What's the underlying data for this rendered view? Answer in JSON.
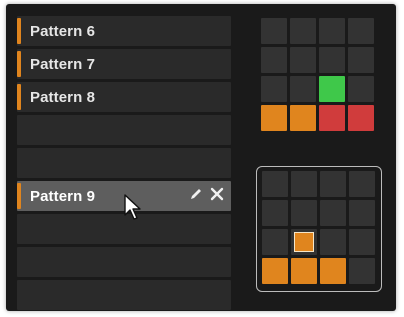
{
  "patterns": {
    "rows": [
      {
        "label": "Pattern 6",
        "has_marker": true
      },
      {
        "label": "Pattern 7",
        "has_marker": true
      },
      {
        "label": "Pattern 8",
        "has_marker": true
      },
      {
        "label": "",
        "has_marker": false
      },
      {
        "label": "",
        "has_marker": false
      },
      {
        "label": "Pattern 9",
        "has_marker": true,
        "selected": true
      },
      {
        "label": "",
        "has_marker": false
      },
      {
        "label": "",
        "has_marker": false
      },
      {
        "label": "",
        "has_marker": false
      }
    ],
    "selected_actions": {
      "edit_icon": "pencil-icon",
      "delete_icon": "close-icon"
    }
  },
  "pad_grids": {
    "top": [
      "off",
      "off",
      "off",
      "off",
      "off",
      "off",
      "off",
      "off",
      "off",
      "off",
      "green",
      "off",
      "orange",
      "orange",
      "red",
      "red"
    ],
    "bottom": [
      "off",
      "off",
      "off",
      "off",
      "off",
      "off",
      "off",
      "off",
      "off",
      "selected-orange",
      "off",
      "off",
      "orange",
      "orange",
      "orange",
      "off"
    ]
  },
  "colors": {
    "accent_orange": "#e0851e",
    "pad_red": "#d03c3c",
    "pad_green": "#3fc84a",
    "pad_off": "#333333",
    "row_bg": "#2a2a2a",
    "row_selected_bg": "#5e5e5e"
  }
}
